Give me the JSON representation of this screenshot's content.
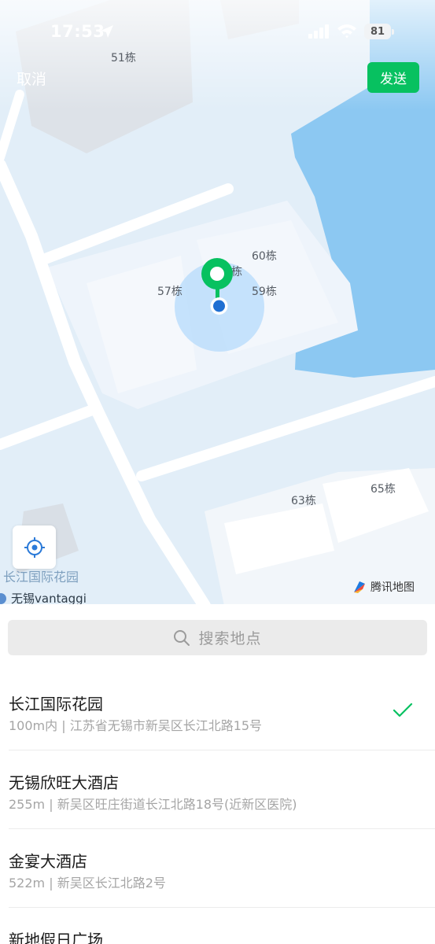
{
  "status_bar": {
    "time": "17:53",
    "battery": "81",
    "icons": [
      "location-arrow-icon",
      "signal-icon",
      "wifi-icon",
      "battery-icon"
    ]
  },
  "header": {
    "cancel_label": "取消",
    "send_label": "发送"
  },
  "map": {
    "building_labels": [
      "51栋",
      "60栋",
      "57栋",
      "栋",
      "59栋",
      "63栋",
      "65栋"
    ],
    "poi_label": "长江国际花园",
    "poi_label_2": "无锡vantaggi",
    "brand": "腾讯地图"
  },
  "search": {
    "placeholder": "搜索地点"
  },
  "places": [
    {
      "name": "长江国际花园",
      "address": "100m内 | 江苏省无锡市新吴区长江北路15号",
      "selected": true
    },
    {
      "name": "无锡欣旺大酒店",
      "address": "255m | 新吴区旺庄街道长江北路18号(近新区医院)",
      "selected": false
    },
    {
      "name": "金宴大酒店",
      "address": "522m | 新吴区长江北路2号",
      "selected": false
    },
    {
      "name": "新地假日广场",
      "address": "",
      "selected": false
    }
  ],
  "colors": {
    "accent": "#07c160",
    "water": "#8cc8f2",
    "map_background": "#e2eef8"
  }
}
